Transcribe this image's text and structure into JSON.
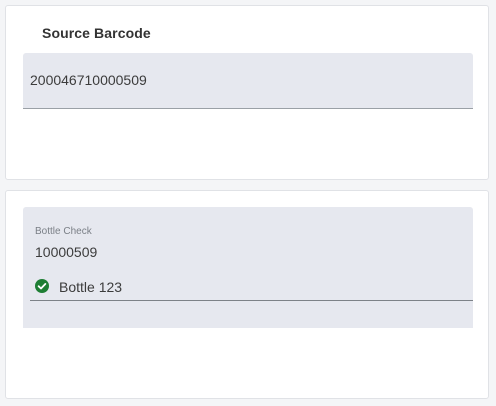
{
  "source_card": {
    "title": "Source Barcode",
    "barcode_value": "200046710000509"
  },
  "bottle_card": {
    "field_label": "Bottle Check",
    "field_value": "10000509",
    "validation": {
      "icon": "check-circle-icon",
      "label": "Bottle 123",
      "color": "#1e7e34"
    }
  }
}
